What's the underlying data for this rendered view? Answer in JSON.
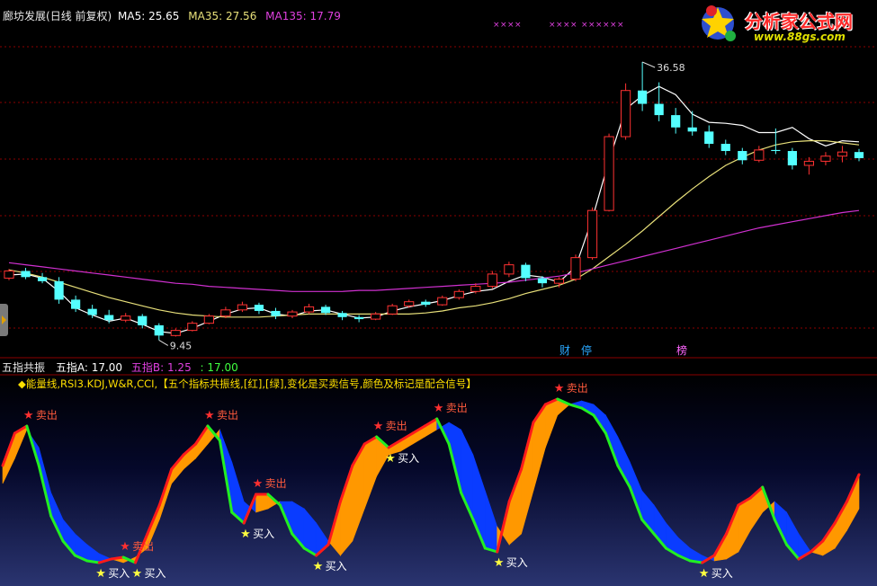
{
  "main_header": {
    "stock": "廊坊发展",
    "period": "(日线 前复权)",
    "ma5": "MA5: 25.65",
    "ma35": "MA35: 27.56",
    "ma135": "MA135: 17.79"
  },
  "sub_header": {
    "name": "五指共振",
    "a": "五指A: 17.00",
    "b": "五指B: 1.25",
    "c": ": 17.00"
  },
  "sub_description": "◆能量线,RSI3.KDJ,W&R,CCI,【五个指标共振线,[红],[绿],变化是买卖信号,颜色及标记是配合信号】",
  "logo": {
    "text": "分析家公式网",
    "url": "www.88gs.com"
  },
  "colors": {
    "up": "#ff3232",
    "down": "#54ffff",
    "ma5": "#ffffff",
    "ma35": "#e8e07a",
    "ma135": "#d030d0",
    "buy_label": "#ffffff",
    "sell_label": "#ff5a3c",
    "star_buy": "#ffff40",
    "star_sell": "#ff3030",
    "osc_red": "#ff1a1a",
    "osc_green": "#22ee22",
    "osc_orange": "#ff9800",
    "osc_blue": "#0a3cff",
    "grid": "#8c0000"
  },
  "chart_data": [
    {
      "type": "candlestick",
      "title": "廊坊发展 (日线 前复权)",
      "ylim": [
        8,
        40
      ],
      "max_label": "36.58",
      "min_label": "9.45",
      "event_markers": [
        "财",
        "停",
        "榜"
      ],
      "ma_series": [
        {
          "name": "MA5",
          "values": [
            15.8,
            15.9,
            15.5,
            14.2,
            12.6,
            11.9,
            11.3,
            11.6,
            11.0,
            10.3,
            10.1,
            10.6,
            11.3,
            12.0,
            12.5,
            12.6,
            12.0,
            11.8,
            12.3,
            12.4,
            12.0,
            11.6,
            11.7,
            12.3,
            12.7,
            13.0,
            13.3,
            13.8,
            14.2,
            14.4,
            15.2,
            15.8,
            15.6,
            15.1,
            16.6,
            21.3,
            27.0,
            32.0,
            33.3,
            34.2,
            33.4,
            31.5,
            30.7,
            30.6,
            30.4,
            29.7,
            29.7,
            30.2,
            29.1,
            28.4,
            28.9,
            28.8
          ]
        },
        {
          "name": "MA35",
          "values": [
            16.3,
            16.0,
            15.6,
            15.1,
            14.6,
            14.1,
            13.6,
            13.2,
            12.8,
            12.4,
            12.1,
            11.9,
            11.8,
            11.7,
            11.7,
            11.7,
            11.8,
            11.9,
            12.0,
            12.0,
            12.0,
            12.0,
            12.0,
            12.0,
            12.0,
            12.1,
            12.3,
            12.6,
            12.8,
            13.1,
            13.5,
            14.0,
            14.4,
            14.8,
            15.4,
            16.4,
            17.6,
            18.8,
            20.1,
            21.5,
            22.9,
            24.2,
            25.4,
            26.5,
            27.3,
            28.0,
            28.5,
            28.8,
            28.9,
            28.9,
            28.7,
            28.5
          ]
        },
        {
          "name": "MA135",
          "values": [
            17.0,
            16.8,
            16.6,
            16.4,
            16.2,
            16.0,
            15.8,
            15.6,
            15.4,
            15.2,
            15.0,
            14.9,
            14.7,
            14.6,
            14.5,
            14.4,
            14.3,
            14.2,
            14.2,
            14.2,
            14.2,
            14.3,
            14.3,
            14.4,
            14.5,
            14.6,
            14.7,
            14.8,
            14.9,
            15.0,
            15.1,
            15.3,
            15.5,
            15.7,
            16.0,
            16.4,
            16.8,
            17.2,
            17.6,
            18.0,
            18.4,
            18.8,
            19.2,
            19.6,
            20.0,
            20.4,
            20.7,
            21.0,
            21.3,
            21.6,
            21.9,
            22.1
          ]
        }
      ],
      "candles": [
        {
          "o": 15.5,
          "h": 16.4,
          "l": 15.3,
          "c": 16.2
        },
        {
          "o": 16.2,
          "h": 16.5,
          "l": 15.4,
          "c": 15.6
        },
        {
          "o": 15.6,
          "h": 16.0,
          "l": 15.0,
          "c": 15.2
        },
        {
          "o": 15.2,
          "h": 15.6,
          "l": 13.0,
          "c": 13.4
        },
        {
          "o": 13.4,
          "h": 13.8,
          "l": 12.2,
          "c": 12.5
        },
        {
          "o": 12.5,
          "h": 12.9,
          "l": 11.6,
          "c": 11.9
        },
        {
          "o": 11.9,
          "h": 12.4,
          "l": 11.1,
          "c": 11.4
        },
        {
          "o": 11.4,
          "h": 12.1,
          "l": 11.2,
          "c": 11.8
        },
        {
          "o": 11.8,
          "h": 12.0,
          "l": 10.6,
          "c": 10.9
        },
        {
          "o": 10.9,
          "h": 11.1,
          "l": 9.45,
          "c": 9.9
        },
        {
          "o": 9.9,
          "h": 10.6,
          "l": 9.8,
          "c": 10.4
        },
        {
          "o": 10.4,
          "h": 11.3,
          "l": 10.3,
          "c": 11.1
        },
        {
          "o": 11.1,
          "h": 12.0,
          "l": 11.0,
          "c": 11.8
        },
        {
          "o": 11.8,
          "h": 12.7,
          "l": 11.6,
          "c": 12.4
        },
        {
          "o": 12.4,
          "h": 13.2,
          "l": 12.2,
          "c": 12.9
        },
        {
          "o": 12.9,
          "h": 13.1,
          "l": 12.0,
          "c": 12.3
        },
        {
          "o": 12.3,
          "h": 12.6,
          "l": 11.5,
          "c": 11.8
        },
        {
          "o": 11.8,
          "h": 12.4,
          "l": 11.6,
          "c": 12.2
        },
        {
          "o": 12.2,
          "h": 13.0,
          "l": 12.0,
          "c": 12.7
        },
        {
          "o": 12.7,
          "h": 12.9,
          "l": 11.9,
          "c": 12.1
        },
        {
          "o": 12.1,
          "h": 12.3,
          "l": 11.4,
          "c": 11.7
        },
        {
          "o": 11.7,
          "h": 11.9,
          "l": 11.2,
          "c": 11.5
        },
        {
          "o": 11.5,
          "h": 12.2,
          "l": 11.4,
          "c": 12.0
        },
        {
          "o": 12.0,
          "h": 13.0,
          "l": 11.9,
          "c": 12.8
        },
        {
          "o": 12.8,
          "h": 13.4,
          "l": 12.6,
          "c": 13.2
        },
        {
          "o": 13.2,
          "h": 13.4,
          "l": 12.7,
          "c": 12.9
        },
        {
          "o": 12.9,
          "h": 13.8,
          "l": 12.8,
          "c": 13.6
        },
        {
          "o": 13.6,
          "h": 14.4,
          "l": 13.4,
          "c": 14.2
        },
        {
          "o": 14.2,
          "h": 15.0,
          "l": 14.0,
          "c": 14.7
        },
        {
          "o": 14.7,
          "h": 16.2,
          "l": 14.5,
          "c": 15.9
        },
        {
          "o": 15.9,
          "h": 17.1,
          "l": 15.6,
          "c": 16.8
        },
        {
          "o": 16.8,
          "h": 17.0,
          "l": 15.2,
          "c": 15.5
        },
        {
          "o": 15.5,
          "h": 15.7,
          "l": 14.6,
          "c": 15.0
        },
        {
          "o": 15.0,
          "h": 15.6,
          "l": 14.6,
          "c": 15.4
        },
        {
          "o": 15.4,
          "h": 17.8,
          "l": 15.2,
          "c": 17.5
        },
        {
          "o": 17.5,
          "h": 22.4,
          "l": 17.3,
          "c": 22.1
        },
        {
          "o": 22.1,
          "h": 29.6,
          "l": 22.0,
          "c": 29.3
        },
        {
          "o": 29.3,
          "h": 34.5,
          "l": 29.0,
          "c": 33.8
        },
        {
          "o": 33.8,
          "h": 36.58,
          "l": 31.8,
          "c": 32.5
        },
        {
          "o": 32.5,
          "h": 34.6,
          "l": 30.8,
          "c": 31.4
        },
        {
          "o": 31.4,
          "h": 32.1,
          "l": 29.6,
          "c": 30.2
        },
        {
          "o": 30.2,
          "h": 31.8,
          "l": 29.4,
          "c": 29.8
        },
        {
          "o": 29.8,
          "h": 30.4,
          "l": 28.2,
          "c": 28.6
        },
        {
          "o": 28.6,
          "h": 29.0,
          "l": 27.5,
          "c": 27.9
        },
        {
          "o": 27.9,
          "h": 28.2,
          "l": 26.6,
          "c": 27.0
        },
        {
          "o": 27.0,
          "h": 28.4,
          "l": 26.8,
          "c": 28.0
        },
        {
          "o": 28.0,
          "h": 30.1,
          "l": 27.6,
          "c": 27.9
        },
        {
          "o": 27.9,
          "h": 28.2,
          "l": 26.1,
          "c": 26.5
        },
        {
          "o": 26.5,
          "h": 27.3,
          "l": 25.6,
          "c": 26.9
        },
        {
          "o": 26.9,
          "h": 27.8,
          "l": 26.5,
          "c": 27.4
        },
        {
          "o": 27.4,
          "h": 28.4,
          "l": 26.8,
          "c": 27.8
        },
        {
          "o": 27.8,
          "h": 28.1,
          "l": 26.9,
          "c": 27.2
        }
      ]
    },
    {
      "type": "area",
      "title": "五指共振",
      "ylim": [
        0,
        100
      ],
      "series": [
        {
          "name": "五指A",
          "values": [
            60,
            78,
            82,
            60,
            32,
            18,
            10,
            7,
            6,
            8,
            9,
            6,
            22,
            38,
            58,
            66,
            72,
            82,
            74,
            34,
            28,
            44,
            44,
            38,
            22,
            14,
            10,
            16,
            40,
            60,
            72,
            76,
            70,
            74,
            78,
            82,
            86,
            72,
            45,
            30,
            14,
            12,
            40,
            58,
            84,
            94,
            97,
            94,
            92,
            88,
            78,
            60,
            48,
            30,
            22,
            14,
            10,
            7,
            6,
            10,
            22,
            38,
            42,
            48,
            30,
            16,
            8,
            12,
            18,
            28,
            40,
            55
          ]
        },
        {
          "name": "五指B",
          "values": [
            50,
            64,
            80,
            70,
            45,
            30,
            22,
            16,
            11,
            8,
            6,
            9,
            14,
            30,
            50,
            58,
            64,
            72,
            80,
            62,
            40,
            34,
            36,
            40,
            40,
            36,
            28,
            18,
            10,
            18,
            36,
            54,
            66,
            68,
            72,
            76,
            80,
            84,
            80,
            66,
            46,
            26,
            16,
            22,
            46,
            70,
            88,
            94,
            96,
            94,
            88,
            76,
            62,
            46,
            38,
            28,
            20,
            14,
            10,
            7,
            8,
            12,
            24,
            34,
            40,
            34,
            22,
            12,
            10,
            14,
            24,
            36
          ]
        }
      ],
      "signals": [
        {
          "label": "买入",
          "kind": "buy"
        },
        {
          "label": "卖出",
          "kind": "sell"
        },
        {
          "label": "卖出",
          "kind": "sell"
        },
        {
          "label": "买入",
          "kind": "buy"
        },
        {
          "label": "卖出",
          "kind": "sell"
        },
        {
          "label": "买入",
          "kind": "buy"
        },
        {
          "label": "卖出",
          "kind": "sell"
        },
        {
          "label": "买入",
          "kind": "buy"
        },
        {
          "label": "卖出",
          "kind": "sell"
        },
        {
          "label": "买入",
          "kind": "buy"
        },
        {
          "label": "卖出",
          "kind": "sell"
        },
        {
          "label": "卖出",
          "kind": "sell"
        },
        {
          "label": "买入",
          "kind": "buy"
        },
        {
          "label": "买入",
          "kind": "buy"
        }
      ]
    }
  ]
}
